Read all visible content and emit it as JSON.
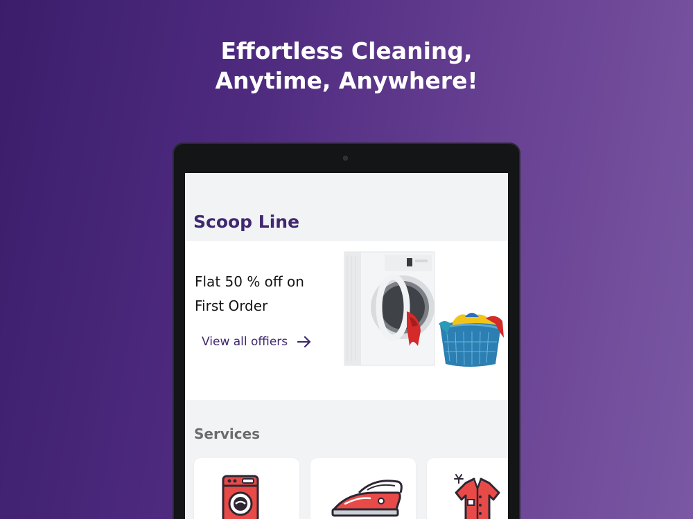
{
  "promo": {
    "headline_line1": "Effortless Cleaning,",
    "headline_line2": "Anytime, Anywhere!"
  },
  "app": {
    "title": "Scoop Line",
    "offer": {
      "text": "Flat 50 % off on First Order",
      "link_label": "View all offiers",
      "link_icon": "arrow-right-icon",
      "image": "washing-machine-with-laundry-basket"
    },
    "services": {
      "title": "Services",
      "items": [
        {
          "icon": "washing-machine-icon"
        },
        {
          "icon": "iron-icon"
        },
        {
          "icon": "shirt-icon"
        }
      ]
    }
  },
  "colors": {
    "brand": "#40286f",
    "background_start": "#3b1d6b",
    "background_end": "#7a58a3",
    "screen_bg": "#f1f3f5",
    "icon_red": "#e84a47",
    "icon_outline": "#2e2633"
  }
}
